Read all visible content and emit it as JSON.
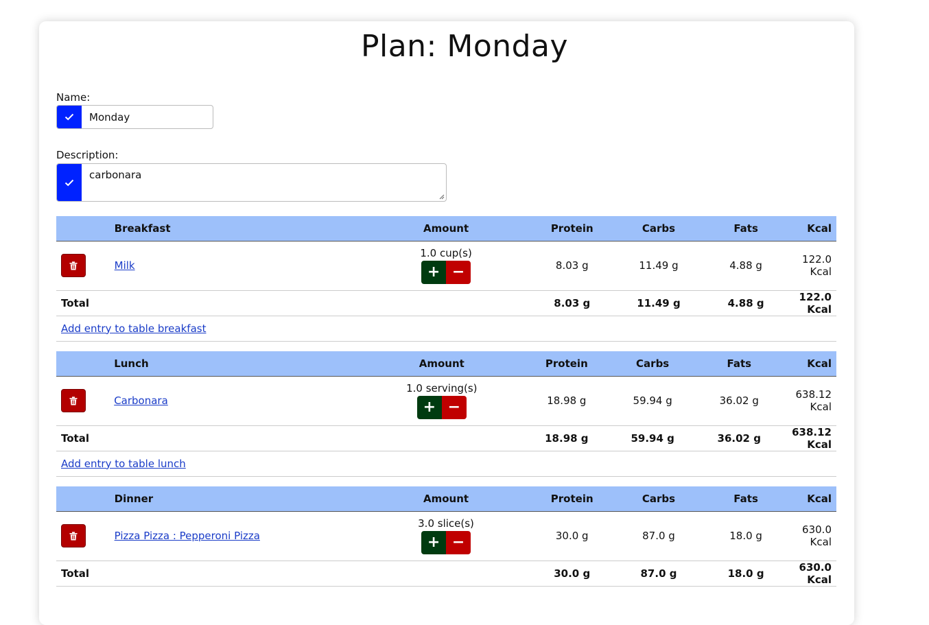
{
  "page": {
    "title": "Plan: Monday"
  },
  "form": {
    "name_label": "Name:",
    "name_value": "Monday",
    "description_label": "Description:",
    "description_value": "carbonara"
  },
  "columns": {
    "amount": "Amount",
    "protein": "Protein",
    "carbs": "Carbs",
    "fats": "Fats",
    "kcal": "Kcal"
  },
  "meals": [
    {
      "name": "Breakfast",
      "entries": [
        {
          "food": "Milk",
          "amount": "1.0 cup(s)",
          "protein": "8.03 g",
          "carbs": "11.49 g",
          "fats": "4.88 g",
          "kcal": "122.0 Kcal"
        }
      ],
      "total": {
        "label": "Total",
        "protein": "8.03 g",
        "carbs": "11.49 g",
        "fats": "4.88 g",
        "kcal": "122.0 Kcal"
      },
      "add_label": "Add entry to table breakfast"
    },
    {
      "name": "Lunch",
      "entries": [
        {
          "food": "Carbonara",
          "amount": "1.0 serving(s)",
          "protein": "18.98 g",
          "carbs": "59.94 g",
          "fats": "36.02 g",
          "kcal": "638.12 Kcal"
        }
      ],
      "total": {
        "label": "Total",
        "protein": "18.98 g",
        "carbs": "59.94 g",
        "fats": "36.02 g",
        "kcal": "638.12 Kcal"
      },
      "add_label": "Add entry to table lunch"
    },
    {
      "name": "Dinner",
      "entries": [
        {
          "food": "Pizza Pizza : Pepperoni Pizza",
          "amount": "3.0 slice(s)",
          "protein": "30.0 g",
          "carbs": "87.0 g",
          "fats": "18.0 g",
          "kcal": "630.0 Kcal"
        }
      ],
      "total": {
        "label": "Total",
        "protein": "30.0 g",
        "carbs": "87.0 g",
        "fats": "18.0 g",
        "kcal": "630.0 Kcal"
      }
    }
  ],
  "icons": {
    "confirm": "check-icon",
    "delete": "trash-icon",
    "increase": "plus-icon",
    "decrease": "minus-icon"
  },
  "colors": {
    "confirm_blue": "#0022ff",
    "header_blue": "#9dc0fa",
    "delete_red": "#b30000",
    "plus_green": "#003b10",
    "minus_red": "#c00000",
    "link": "#1a3cc8"
  }
}
